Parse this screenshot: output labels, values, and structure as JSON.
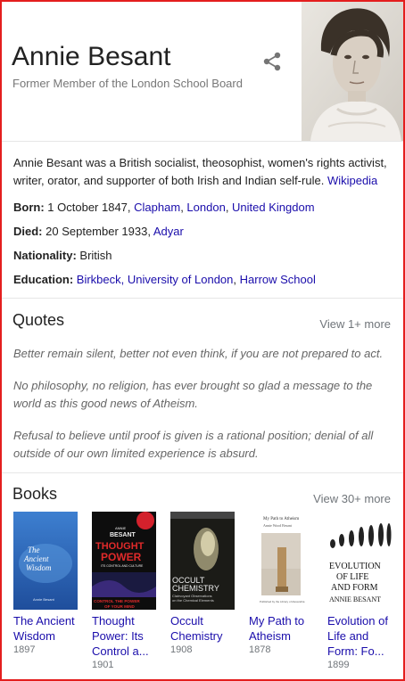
{
  "header": {
    "title": "Annie Besant",
    "subtitle": "Former Member of the London School Board"
  },
  "description": {
    "text": "Annie Besant was a British socialist, theosophist, women's rights activist, writer, orator, and supporter of both Irish and Indian self-rule.",
    "source_link": "Wikipedia"
  },
  "facts": {
    "born": {
      "label": "Born:",
      "value": "1 October 1847,",
      "links": [
        "Clapham",
        "London",
        "United Kingdom"
      ]
    },
    "died": {
      "label": "Died:",
      "value": "20 September 1933,",
      "links": [
        "Adyar"
      ]
    },
    "nationality": {
      "label": "Nationality:",
      "value": "British"
    },
    "education": {
      "label": "Education:",
      "links": [
        "Birkbeck, University of London",
        "Harrow School"
      ]
    }
  },
  "quotes": {
    "title": "Quotes",
    "more": "View 1+ more",
    "items": [
      "Better remain silent, better not even think, if you are not prepared to act.",
      "No philosophy, no religion, has ever brought so glad a message to the world as this good news of Atheism.",
      "Refusal to believe until proof is given is a rational position; denial of all outside of our own limited experience is absurd."
    ]
  },
  "books": {
    "title": "Books",
    "more": "View 30+ more",
    "items": [
      {
        "title": "The Ancient Wisdom",
        "year": "1897",
        "cover_text": [
          "The",
          "Ancient",
          "Wisdom",
          "Annie Besant"
        ]
      },
      {
        "title": "Thought Power: Its Control a...",
        "year": "1901",
        "cover_text": [
          "ANNIE",
          "BESANT",
          "THOUGHT",
          "POWER",
          "ITS CONTROL AND CULTURE",
          "CONTROL THE POWER",
          "OF YOUR MIND"
        ]
      },
      {
        "title": "Occult Chemistry",
        "year": "1908",
        "cover_text": [
          "OCCULT",
          "CHEMISTRY",
          "Clairvoyant Observations",
          "on the Chemical Elements"
        ]
      },
      {
        "title": "My Path to Atheism",
        "year": "1878",
        "cover_text": [
          "My Path to Atheism",
          "Annie Wood Besant",
          "Published by the Library of Alexandria"
        ]
      },
      {
        "title": "Evolution of Life and Form: Fo...",
        "year": "1899",
        "cover_text": [
          "EVOLUTION",
          "OF LIFE",
          "AND FORM",
          "ANNIE BESANT"
        ]
      }
    ]
  },
  "colors": {
    "link": "#1a0dab",
    "frame": "#e41e1e",
    "muted": "#70757a"
  }
}
